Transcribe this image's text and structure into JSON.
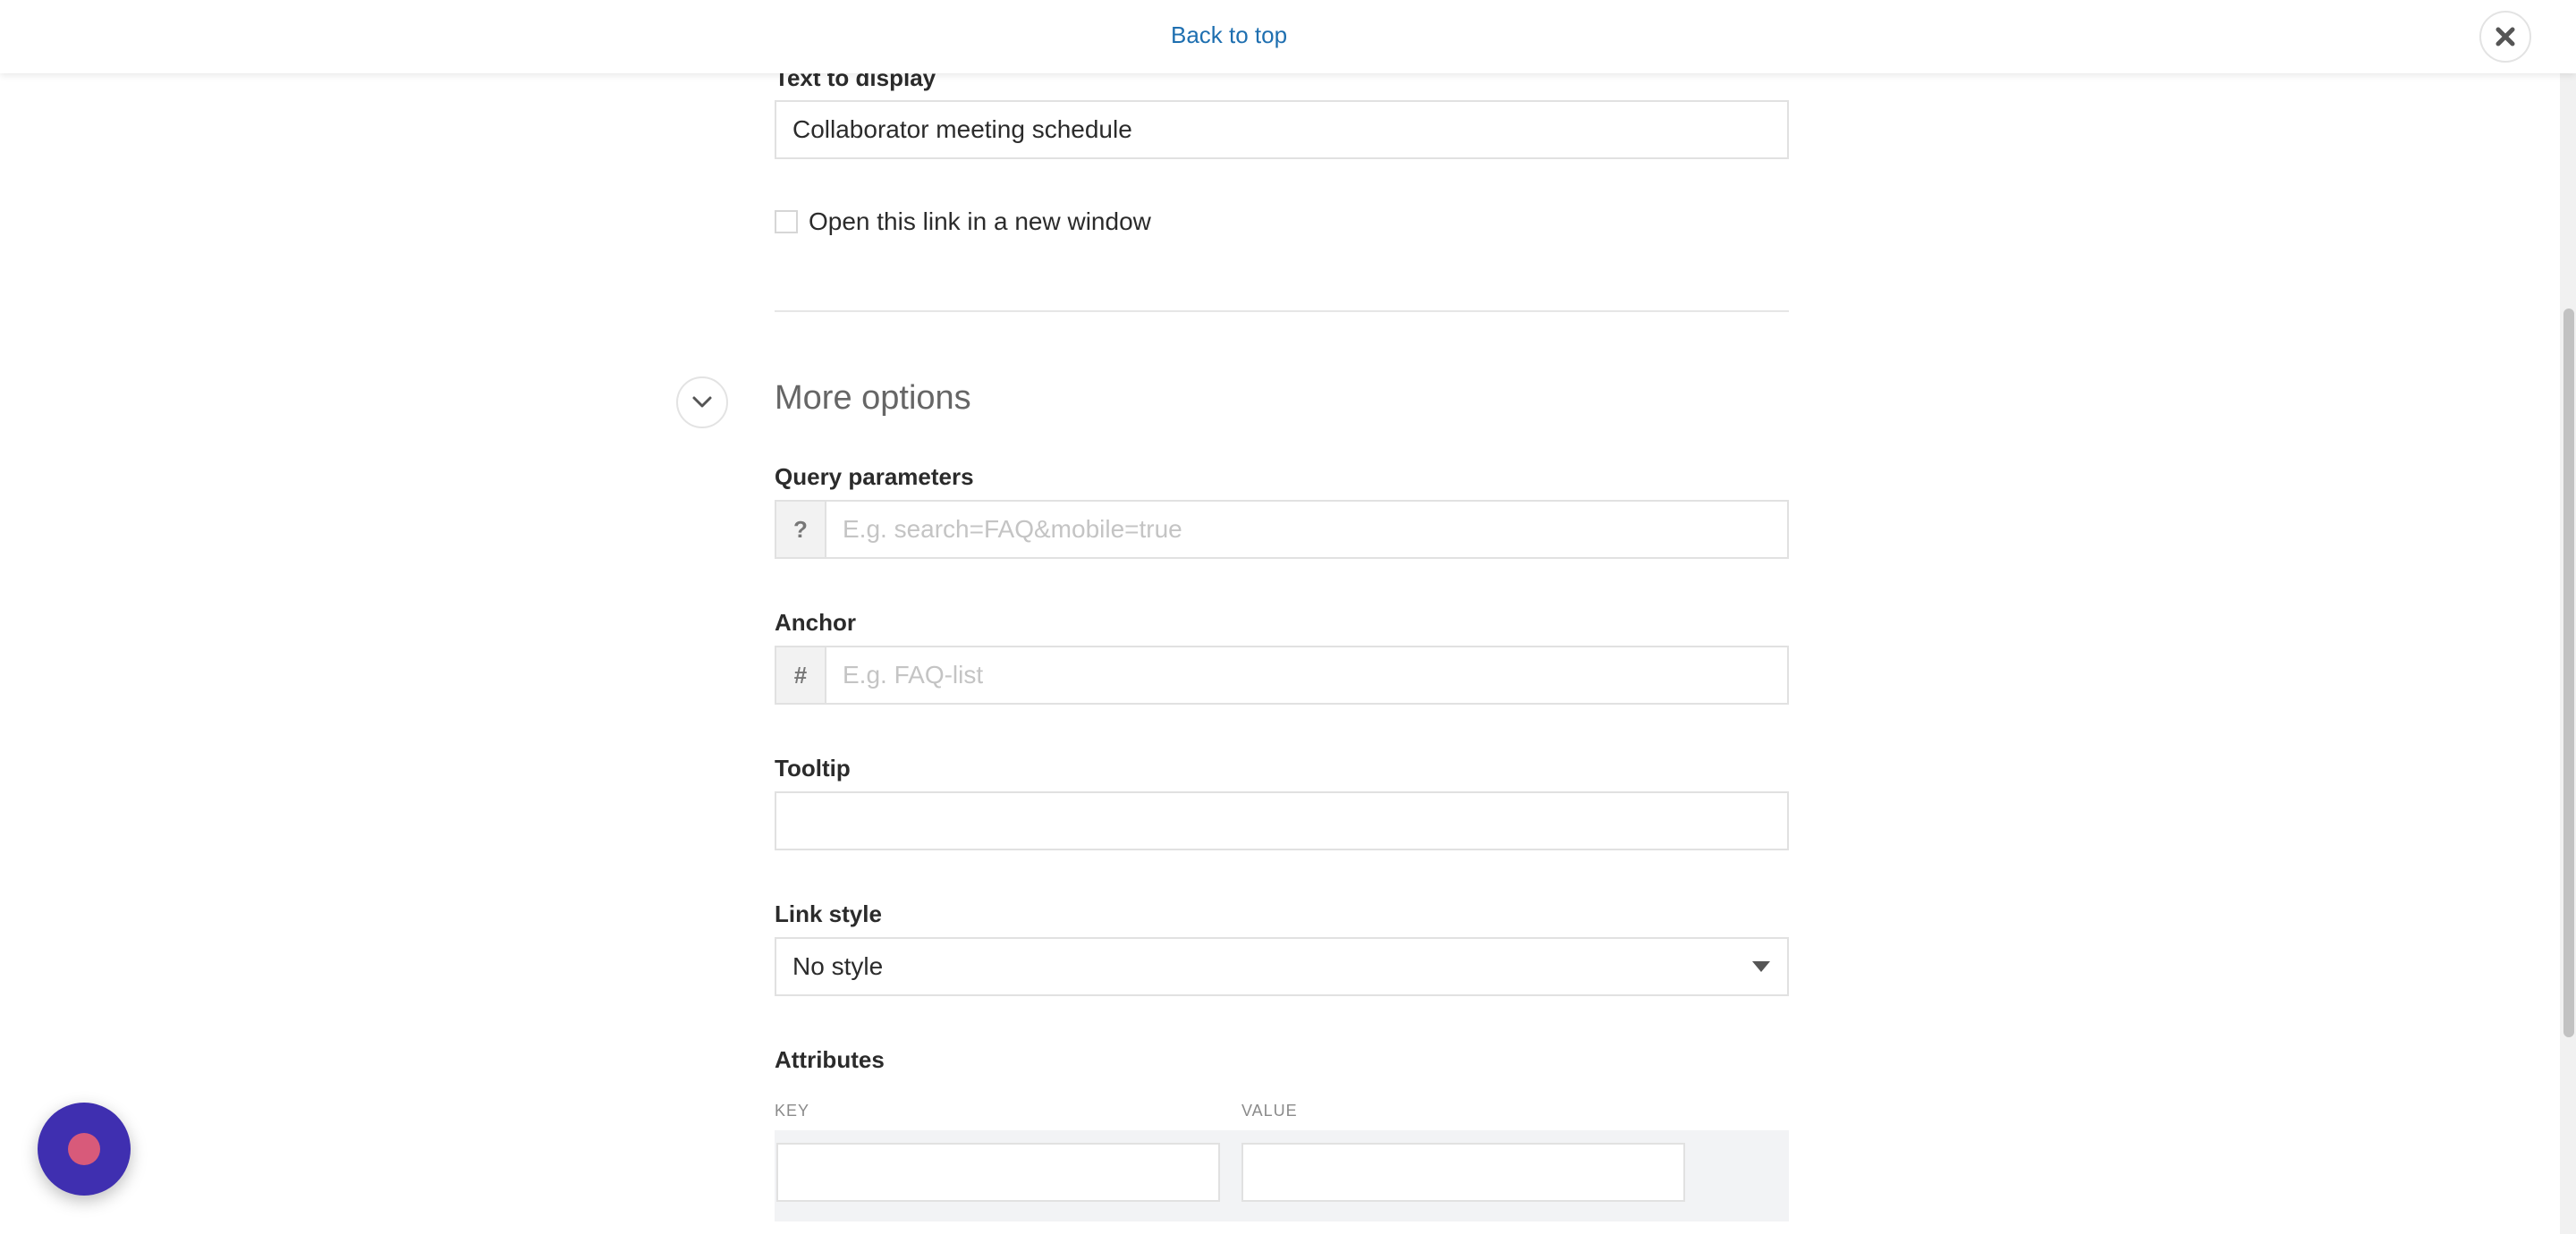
{
  "header": {
    "back_to_top": "Back to top"
  },
  "form": {
    "text_to_display": {
      "label": "Text to display",
      "value": "Collaborator meeting schedule"
    },
    "new_window": {
      "label": "Open this link in a new window",
      "checked": false
    },
    "more_options": {
      "title": "More options"
    },
    "query_parameters": {
      "label": "Query parameters",
      "prefix": "?",
      "placeholder": "E.g. search=FAQ&mobile=true"
    },
    "anchor": {
      "label": "Anchor",
      "prefix": "#",
      "placeholder": "E.g. FAQ-list"
    },
    "tooltip": {
      "label": "Tooltip",
      "value": ""
    },
    "link_style": {
      "label": "Link style",
      "selected": "No style"
    },
    "attributes": {
      "label": "Attributes",
      "key_header": "KEY",
      "value_header": "VALUE"
    }
  },
  "colors": {
    "link": "#1e6fb0",
    "fab_bg": "#3f2fb0",
    "fab_dot": "#d85a7a"
  }
}
